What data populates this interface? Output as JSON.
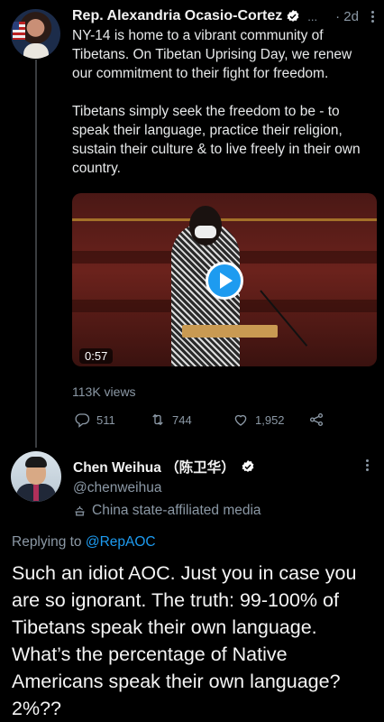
{
  "tweet1": {
    "author_name": "Rep. Alexandria Ocasio-Cortez",
    "ellipsis": "...",
    "time": "· 2d",
    "paragraphs": [
      "NY-14 is home to a vibrant community of Tibetans. On Tibetan Uprising Day, we renew our commitment to their fight for freedom.",
      "Tibetans simply seek the freedom to be - to speak their language, practice their religion, sustain their culture & to live freely in their own country."
    ],
    "video_duration": "0:57",
    "views": "113K views",
    "replies": "511",
    "retweets": "744",
    "likes": "1,952"
  },
  "tweet2": {
    "author_name": "Chen Weihua （陈卫华）",
    "handle": "@chenweihua",
    "affiliation_label": "China state-affiliated media",
    "replying_prefix": "Replying to",
    "replying_mention": "@RepAOC",
    "text": "Such an idiot AOC. Just you in case you are so ignorant.  The truth: 99-100% of Tibetans speak their own language.  What’s the percentage of Native Americans speak their own language? 2%??"
  },
  "colors": {
    "background": "#000000",
    "accent": "#1d9bf0",
    "secondary_text": "#8b98a5"
  },
  "icons": [
    "verified-badge-icon",
    "more-options-icon",
    "play-icon",
    "reply-icon",
    "retweet-icon",
    "like-icon",
    "share-icon",
    "state-media-icon"
  ]
}
